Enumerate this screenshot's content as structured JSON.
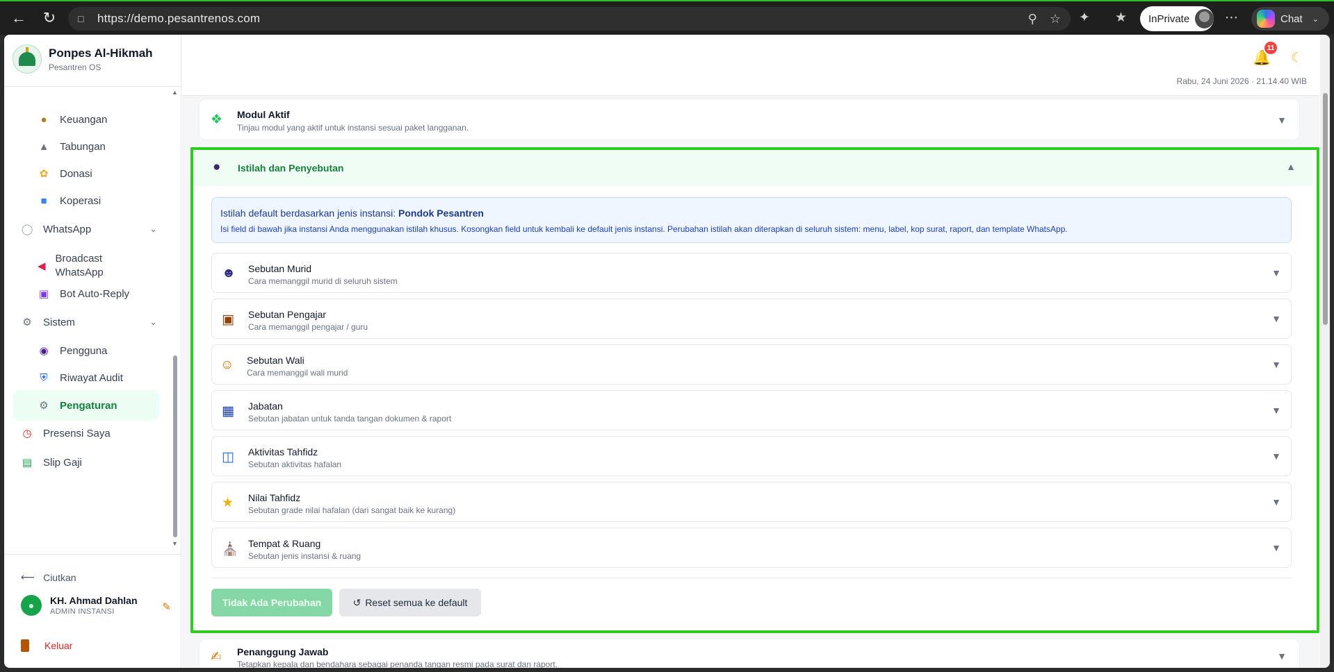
{
  "browser": {
    "url": "https://demo.pesantrenos.com",
    "inprivate_label": "InPrivate",
    "chat_label": "Chat"
  },
  "sidebar": {
    "brand_name": "Ponpes Al-Hikmah",
    "brand_sub": "Pesantren OS",
    "items": [
      {
        "label": "Keuangan",
        "icon": "money-bag-icon"
      },
      {
        "label": "Tabungan",
        "icon": "bank-icon"
      },
      {
        "label": "Donasi",
        "icon": "hands-icon"
      },
      {
        "label": "Koperasi",
        "icon": "shop-icon"
      },
      {
        "label": "WhatsApp",
        "icon": "chat-bubble-icon"
      },
      {
        "label": "Broadcast WhatsApp",
        "icon": "megaphone-icon"
      },
      {
        "label": "Bot Auto-Reply",
        "icon": "robot-icon"
      },
      {
        "label": "Sistem",
        "icon": "gear-icon"
      },
      {
        "label": "Pengguna",
        "icon": "users-icon"
      },
      {
        "label": "Riwayat Audit",
        "icon": "shield-icon"
      },
      {
        "label": "Pengaturan",
        "icon": "gear-icon"
      },
      {
        "label": "Presensi Saya",
        "icon": "alarm-clock-icon"
      },
      {
        "label": "Slip Gaji",
        "icon": "banknote-icon"
      }
    ],
    "collapse_label": "Ciutkan",
    "user_name": "KH. Ahmad Dahlan",
    "user_role": "ADMIN INSTANSI",
    "logout_label": "Keluar"
  },
  "topbar": {
    "notif_count": "11",
    "datetime": "Rabu, 24 Juni 2026 · 21.14.40 WIB"
  },
  "modul_aktif": {
    "title": "Modul Aktif",
    "subtitle": "Tinjau modul yang aktif untuk instansi sesuai paket langganan."
  },
  "istilah": {
    "title": "Istilah dan Penyebutan",
    "info_prefix": "Istilah default berdasarkan jenis instansi:",
    "info_type": "Pondok Pesantren",
    "info_text": "Isi field di bawah jika instansi Anda menggunakan istilah khusus. Kosongkan field untuk kembali ke default jenis instansi. Perubahan istilah akan diterapkan di seluruh sistem: menu, label, kop surat, raport, dan template WhatsApp.",
    "rows": [
      {
        "title": "Sebutan Murid",
        "subtitle": "Cara memanggil murid di seluruh sistem",
        "icon": "student-icon"
      },
      {
        "title": "Sebutan Pengajar",
        "subtitle": "Cara memanggil pengajar / guru",
        "icon": "teacher-icon"
      },
      {
        "title": "Sebutan Wali",
        "subtitle": "Cara memanggil wali murid",
        "icon": "family-icon"
      },
      {
        "title": "Jabatan",
        "subtitle": "Sebutan jabatan untuk tanda tangan dokumen & raport",
        "icon": "position-icon"
      },
      {
        "title": "Aktivitas Tahfidz",
        "subtitle": "Sebutan aktivitas hafalan",
        "icon": "open-book-icon"
      },
      {
        "title": "Nilai Tahfidz",
        "subtitle": "Sebutan grade nilai hafalan (dari sangat baik ke kurang)",
        "icon": "star-icon"
      },
      {
        "title": "Tempat & Ruang",
        "subtitle": "Sebutan jenis instansi & ruang",
        "icon": "building-icon"
      }
    ],
    "save_label": "Tidak Ada Perubahan",
    "reset_label": "Reset semua ke default"
  },
  "penanggung": {
    "title": "Penanggung Jawab",
    "subtitle": "Tetapkan kepala dan bendahara sebagai penanda tangan resmi pada surat dan raport."
  },
  "colors": {
    "accent_green": "#15803d",
    "highlight_border": "#2ecc21",
    "danger": "#dc2626"
  }
}
